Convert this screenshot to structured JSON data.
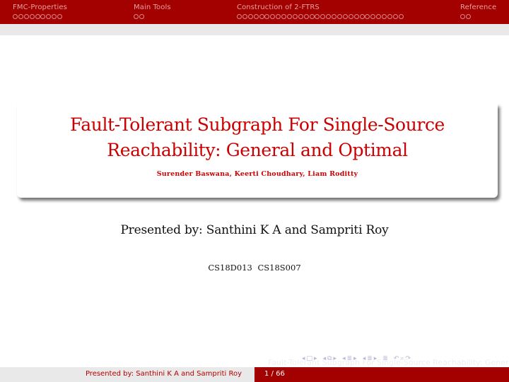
{
  "header": {
    "sections": [
      {
        "label": "FMC-Properties",
        "frames": 9
      },
      {
        "label": "Main Tools",
        "frames": 2
      },
      {
        "label": "Construction of 2-FTRS",
        "frames": 30
      },
      {
        "label": "Reference",
        "frames": 2
      }
    ],
    "colors": {
      "bar": "#a30000",
      "section_text": "#e8a0a0",
      "subbar": "#e9e9e9"
    }
  },
  "title_block": {
    "title_line1": "Fault-Tolerant Subgraph For Single-Source",
    "title_line2": "Reachability: General and Optimal",
    "authors": "Surender Baswana, Keerti Choudhary, Liam Roditty",
    "color": "#cc0000"
  },
  "body": {
    "presented_by": "Presented by: Santhini K A and Sampriti Roy",
    "student_ids": "CS18D013  CS18S007"
  },
  "navigation": {
    "icons": [
      "frame-prev-icon",
      "frame-icon",
      "frame-next-icon",
      "subsection-prev-icon",
      "subsection-icon",
      "subsection-next-icon",
      "section-prev-icon",
      "section-icon",
      "section-next-icon",
      "doc-prev-icon",
      "doc-icon",
      "doc-next-icon",
      "toc-icon",
      "back-icon",
      "search-icon",
      "forward-icon"
    ],
    "ghost_title": "Fault-Tolerant Subgraph For Single-Source Reachability: General and Optimal"
  },
  "footer": {
    "left_text": "Presented by: Santhini K A and Sampriti Roy",
    "page_current": 1,
    "page_total": 66,
    "page_label": "1 / 66"
  }
}
